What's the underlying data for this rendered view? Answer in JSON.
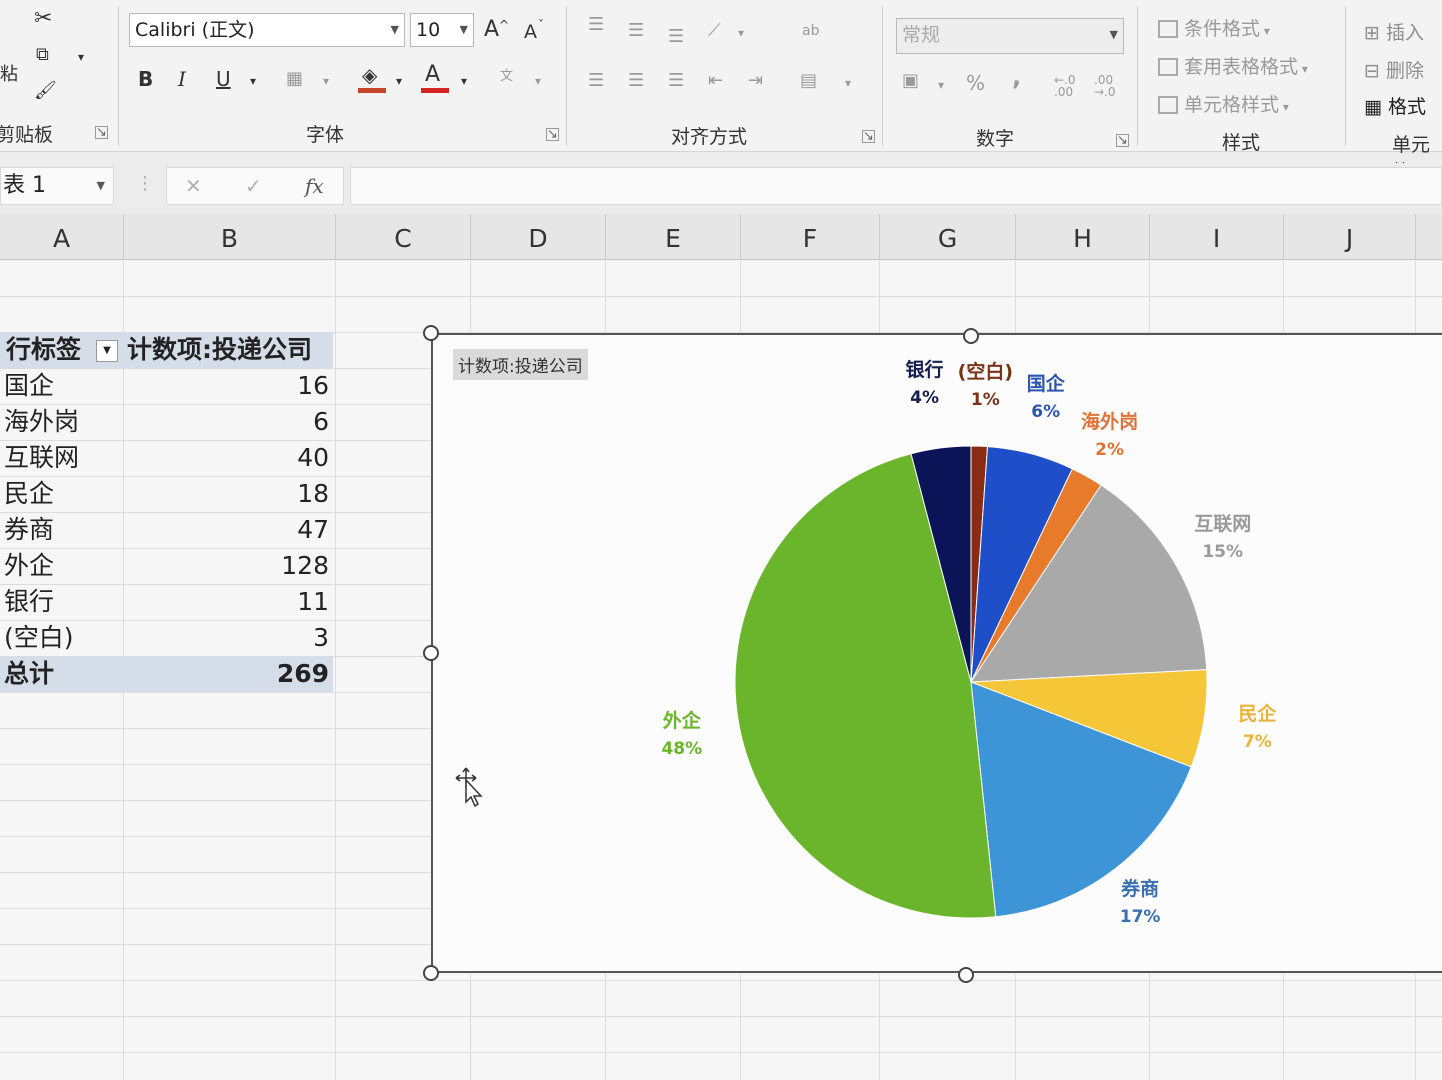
{
  "ribbon": {
    "clipboard": {
      "label": "剪贴板",
      "paste_label": "粘"
    },
    "font": {
      "label": "字体",
      "font_name": "Calibri (正文)",
      "font_size": "10",
      "bold": "B",
      "italic": "I",
      "underline": "U",
      "grow": "A",
      "shrink": "A"
    },
    "alignment": {
      "label": "对齐方式"
    },
    "number": {
      "label": "数字",
      "format": "常规",
      "percent": "%",
      "comma": ","
    },
    "styles": {
      "label": "样式",
      "conditional": "条件格式",
      "table": "套用表格格式",
      "cell_styles": "单元格样式"
    },
    "cells": {
      "label": "单元格",
      "insert": "插入",
      "delete": "删除",
      "format": "格式"
    }
  },
  "formula_bar": {
    "name_box": "表 1",
    "fx": "fx",
    "cancel": "✕",
    "enter": "✓"
  },
  "columns": [
    "A",
    "B",
    "C",
    "D",
    "E",
    "F",
    "G",
    "H",
    "I",
    "J"
  ],
  "pivot": {
    "header_label": "行标签",
    "header_value": "计数项:投递公司",
    "rows": [
      {
        "label": "国企",
        "value": "16"
      },
      {
        "label": "海外岗",
        "value": "6"
      },
      {
        "label": "互联网",
        "value": "40"
      },
      {
        "label": "民企",
        "value": "18"
      },
      {
        "label": "券商",
        "value": "47"
      },
      {
        "label": "外企",
        "value": "128"
      },
      {
        "label": "银行",
        "value": "11"
      },
      {
        "label": "(空白)",
        "value": "3"
      }
    ],
    "total_label": "总计",
    "total_value": "269"
  },
  "chart_data": {
    "type": "pie",
    "title": "计数项:投递公司",
    "categories": [
      "国企",
      "海外岗",
      "互联网",
      "民企",
      "券商",
      "外企",
      "银行",
      "(空白)"
    ],
    "values": [
      16,
      6,
      40,
      18,
      47,
      128,
      11,
      3
    ],
    "percent_labels": [
      "6%",
      "2%",
      "15%",
      "7%",
      "17%",
      "48%",
      "4%",
      "1%"
    ],
    "colors": [
      "#1f4fc8",
      "#e87a2c",
      "#a9a9a9",
      "#f5c637",
      "#3d95d8",
      "#6bb52c",
      "#0a1456",
      "#8a2b14"
    ],
    "label_colors": [
      "#2b55b0",
      "#e0733a",
      "#9a9a9a",
      "#e8b53a",
      "#3a6fb0",
      "#6bb52c",
      "#15204f",
      "#7a3318"
    ],
    "legend": "none"
  }
}
